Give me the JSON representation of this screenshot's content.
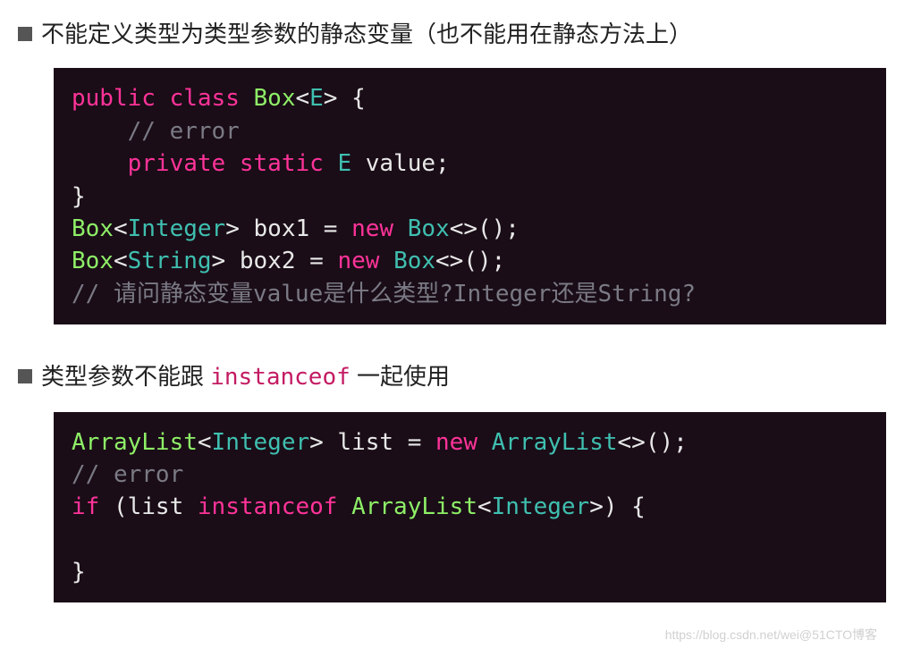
{
  "section1": {
    "bullet": "不能定义类型为类型参数的静态变量（也不能用在静态方法上）",
    "code": {
      "l1a": "public",
      "l1b": "class",
      "l1c": "Box",
      "l1d": "E",
      "l1e": " {",
      "l2": "    // error",
      "l3a": "private",
      "l3b": "static",
      "l3c": "E",
      "l3d": " value;",
      "l4": "}",
      "l5a": "Box",
      "l5b": "Integer",
      "l5c": "> box1 = ",
      "l5d": "new",
      "l5e": "Box",
      "l5f": "<>();",
      "l6a": "Box",
      "l6b": "String",
      "l6c": "> box2 = ",
      "l6d": "new",
      "l6e": "Box",
      "l6f": "<>();",
      "l7": "// 请问静态变量value是什么类型?Integer还是String?"
    }
  },
  "section2": {
    "bullet_pre": "类型参数不能跟 ",
    "bullet_kw": "instanceof",
    "bullet_post": " 一起使用",
    "code": {
      "l1a": "ArrayList",
      "l1b": "Integer",
      "l1c": "> list = ",
      "l1d": "new",
      "l1e": "ArrayList",
      "l1f": "<>();",
      "l2": "// error",
      "l3a": "if",
      "l3b": " (list ",
      "l3c": "instanceof",
      "l3d": "ArrayList",
      "l3e": "Integer",
      "l3f": ">) {",
      "l4": "",
      "l5": "}"
    }
  },
  "watermark": "https://blog.csdn.net/wei@51CTO博客"
}
